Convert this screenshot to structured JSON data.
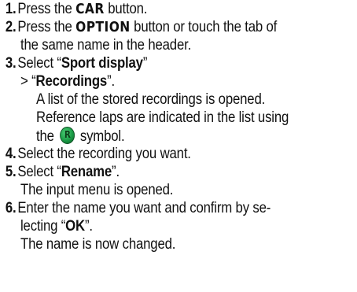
{
  "steps": [
    {
      "num": "1.",
      "pre": "Press the ",
      "bold": "CAR",
      "post": " button."
    },
    {
      "num": "2.",
      "pre": "Press the ",
      "bold": "OPTION",
      "post": " button or touch the tab of",
      "cont": "the same name in the header."
    },
    {
      "num": "3.",
      "pre": "Select “",
      "bold": "Sport display",
      "post": "”",
      "sub_pre": "> “",
      "sub_bold": "Recordings",
      "sub_post": "”.",
      "desc1": "A list of the stored recordings is opened.",
      "desc2": "Reference laps are indicated in the list using",
      "desc3_pre": "the ",
      "desc3_post": " symbol."
    },
    {
      "num": "4.",
      "text": "Select the recording you want."
    },
    {
      "num": "5.",
      "pre": "Select “",
      "bold": "Rename",
      "post": "”.",
      "cont": "The input menu is opened."
    },
    {
      "num": "6.",
      "text": "Enter the name you want and confirm by se-",
      "cont_pre": "lecting “",
      "cont_bold": "OK",
      "cont_post": "”.",
      "cont2": "The name is now changed."
    }
  ],
  "icons": {
    "recording_symbol": "reference-lap-icon",
    "symbol_color": "#1a9a45"
  }
}
